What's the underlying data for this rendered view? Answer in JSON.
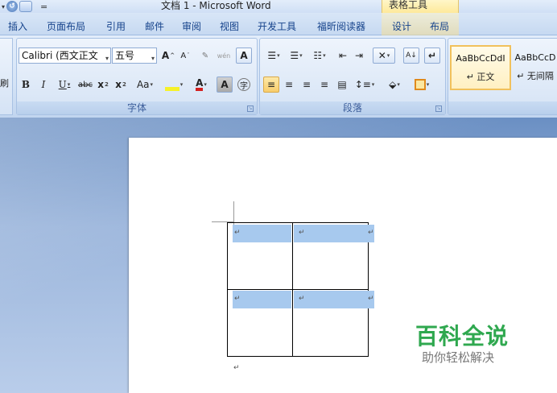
{
  "title_bar": {
    "window_title": "文档 1 - Microsoft Word",
    "context_title": "表格工具",
    "quick_access": {
      "undo_glyph": "↺",
      "customize_glyph": "="
    }
  },
  "tabs": [
    "插入",
    "页面布局",
    "引用",
    "邮件",
    "审阅",
    "视图",
    "开发工具",
    "福昕阅读器",
    "设计",
    "布局"
  ],
  "left_stub": {
    "glyph": "刷"
  },
  "font_group": {
    "label": "字体",
    "font_name": "Calibri (西文正文",
    "font_size": "五号",
    "grow_label": "A",
    "shrink_label": "A",
    "clear_label": "A",
    "bold": "B",
    "italic": "I",
    "underline": "U",
    "strike": "abc",
    "subscript": "x",
    "superscript": "x",
    "case": "Aa",
    "highlight": "ab",
    "font_color": "A",
    "shade": "A",
    "circle": "字"
  },
  "paragraph_group": {
    "label": "段落",
    "sort": "A↓",
    "marks": "↵"
  },
  "styles_group": {
    "styles": [
      {
        "sample": "AaBbCcDdI",
        "name": "↵ 正文"
      },
      {
        "sample": "AaBbCcD",
        "name": "↵ 无间隔"
      }
    ]
  },
  "document": {
    "paragraph_mark": "↵",
    "watermark_main": "百科全说",
    "watermark_sub": "助你轻松解决"
  },
  "colors": {
    "accent": "#15428b",
    "cell_highlight": "#a7c9ee",
    "watermark_green": "#2fa84f",
    "context_tab": "#fde68f"
  }
}
